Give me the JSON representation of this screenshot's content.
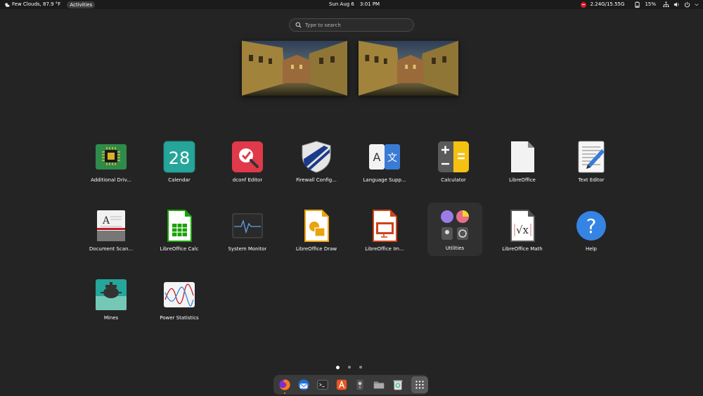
{
  "topbar": {
    "weather": "Few Clouds, 87.9 °F",
    "activities": "Activities",
    "date": "Sun Aug 6",
    "time": "3:01 PM",
    "memory": "2.24G/15.55G",
    "battery": "15%"
  },
  "search": {
    "placeholder": "Type to search"
  },
  "apps": {
    "additional_drivers": "Additional Driv...",
    "calendar": "Calendar",
    "calendar_day": "28",
    "dconf_editor": "dconf Editor",
    "firewall": "Firewall Config...",
    "language": "Language Supp...",
    "calculator": "Calculator",
    "libreoffice": "LibreOffice",
    "text_editor": "Text Editor",
    "document_scanner": "Document Scan...",
    "lo_calc": "LibreOffice Calc",
    "system_monitor": "System Monitor",
    "lo_draw": "LibreOffice Draw",
    "lo_impress": "LibreOffice Im...",
    "utilities": "Utilities",
    "lo_math": "LibreOffice Math",
    "help": "Help",
    "mines": "Mines",
    "power_stats": "Power Statistics"
  },
  "pagination": {
    "pages": 3,
    "current": 1
  },
  "dock": [
    "firefox-icon",
    "thunderbird-icon",
    "terminal-icon",
    "app-center-icon",
    "disk-icon",
    "files-icon",
    "trash-icon",
    "show-apps-icon"
  ],
  "colors": {
    "background": "#242424",
    "topbar": "#1b1b1b",
    "dock": "#3a3a3a",
    "accent": "#e95420"
  }
}
